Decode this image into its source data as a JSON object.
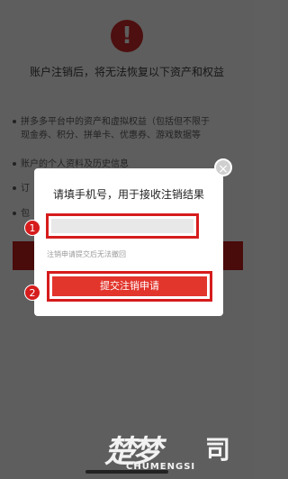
{
  "background": {
    "title": "账户注销后，将无法恢复以下资产和权益",
    "items": [
      "拼多多平台中的资产和虚拟权益（包括但不限于",
      "现金券、积分、拼单卡、优惠券、游戏数据等",
      "账户的个人资料及历史信息",
      "订",
      "包"
    ],
    "warning_glyph": "!"
  },
  "modal": {
    "title": "请填手机号，用于接收注销结果",
    "phone_value": "",
    "note": "注销申请提交后无法撤回",
    "submit_label": "提交注销申请",
    "close_glyph": "×"
  },
  "annotations": {
    "step1": "1",
    "step2": "2"
  },
  "watermark": {
    "cn": "楚梦",
    "en": "CHUMENGSI",
    "right": "司"
  },
  "colors": {
    "accent": "#e2352c",
    "highlight": "#d61c1c",
    "overlay": "#5e5e5e"
  }
}
